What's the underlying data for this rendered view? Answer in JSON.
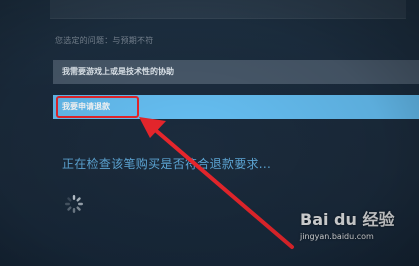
{
  "question_label": "您选定的问题：与预期不符",
  "options": [
    {
      "label": "我需要游戏上或是技术性的协助",
      "selected": false
    },
    {
      "label": "我要申请退款",
      "selected": true
    }
  ],
  "status_text": "正在检查该笔购买是否符合退款要求...",
  "watermark": {
    "logo": "Bai du 经验",
    "url": "jingyan.baidu.com"
  },
  "colors": {
    "background": "#1b2838",
    "option_default": "#495a6c",
    "option_selected": "#66c0f4",
    "status_text": "#5ea8d8",
    "annotation_red": "#e8262c"
  },
  "icons": {
    "spinner": "loading-spinner-icon",
    "paw": "baidu-paw-icon"
  }
}
